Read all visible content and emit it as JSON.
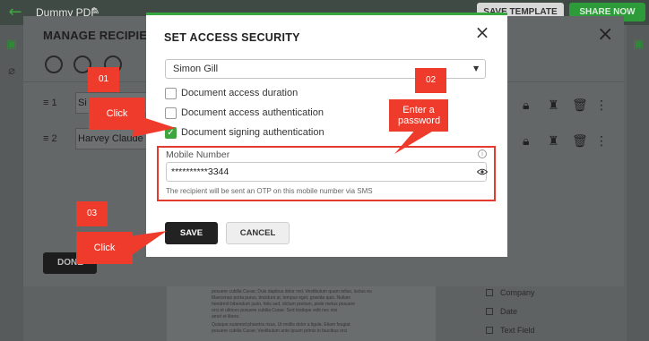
{
  "app": {
    "doc_title": "Dummy PDF",
    "save_template": "SAVE TEMPLATE",
    "share_now": "SHARE NOW"
  },
  "recipients_panel": {
    "title": "MANAGE RECIPIENTS",
    "rows": [
      {
        "num": "1",
        "name": "Si"
      },
      {
        "num": "2",
        "name": "Harvey Claude"
      }
    ],
    "done_label": "DONE"
  },
  "fields_panel": {
    "items": [
      "Company",
      "Date",
      "Text Field"
    ]
  },
  "document_preview": {
    "lines": [
      "posuere cubilia Curae; Duis dapibus dolor nisl. Vestibulum quam tellus, luctus eu",
      "Maecenas porta purus, tincidunt at, tempus eget, gravida quis. Nullam",
      "hendrerit bibendum justo, felis sed, dictum pretium, pede metus posuere",
      "orci et ultrices posuere cubilia Curae. Sed tristique velit nec nisi",
      "amet et libero.",
      "Quisque euismod pharetra risus. Ut mollis dolor a ligula. Etiam feugiat",
      "posuere cubilia Curae; Vestibulum ante ipsum primis in faucibus orci"
    ]
  },
  "modal": {
    "title": "SET ACCESS SECURITY",
    "recipient_selected": "Simon Gill",
    "options": [
      {
        "label": "Document access duration",
        "checked": false
      },
      {
        "label": "Document access authentication",
        "checked": false
      },
      {
        "label": "Document signing authentication",
        "checked": true
      }
    ],
    "mobile_label": "Mobile Number",
    "mobile_value": "**********3344",
    "otp_hint": "The recipient will be sent an OTP on this mobile number via SMS",
    "save_label": "SAVE",
    "cancel_label": "CANCEL"
  },
  "annotations": {
    "step1": "01",
    "step2": "02",
    "step3": "03",
    "click1": "Click",
    "enter_password": "Enter a password",
    "click3": "Click"
  },
  "colors": {
    "accent_green": "#36a83f",
    "annotation_red": "#ee3b2b"
  }
}
